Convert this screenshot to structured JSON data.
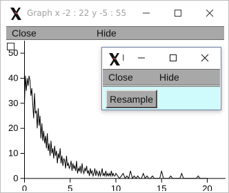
{
  "main_window": {
    "title": "Graph  x -2 : 22  y -5 : 55",
    "menu": {
      "close_label": "Close",
      "hide_label": "Hide"
    }
  },
  "small_window": {
    "title": "I",
    "menu": {
      "close_label": "Close",
      "hide_label": "Hide"
    },
    "resample_label": "Resample",
    "panel_color": "#d0fbfd"
  },
  "chart_data": {
    "type": "line",
    "title": "",
    "xlabel": "",
    "ylabel": "",
    "xlim": [
      -2,
      22
    ],
    "ylim": [
      -5,
      55
    ],
    "x_ticks": [
      0,
      5,
      10,
      15,
      20
    ],
    "y_ticks": [
      0,
      10,
      20,
      30,
      40,
      50
    ],
    "series": [
      {
        "x": [
          0.0,
          0.1,
          0.2,
          0.3,
          0.4,
          0.5,
          0.6,
          0.7,
          0.8,
          0.9,
          1.0,
          1.1,
          1.2,
          1.3,
          1.4,
          1.5,
          1.6,
          1.7,
          1.8,
          1.9,
          2.0,
          2.1,
          2.2,
          2.3,
          2.4,
          2.5,
          2.6,
          2.7,
          2.8,
          2.9,
          3.0,
          3.1,
          3.2,
          3.3,
          3.4,
          3.5,
          3.6,
          3.7,
          3.8,
          3.9,
          4.0,
          4.1,
          4.2,
          4.3,
          4.4,
          4.5,
          4.6,
          4.7,
          4.8,
          4.9,
          5.0,
          5.1,
          5.2,
          5.3,
          5.4,
          5.5,
          5.6,
          5.7,
          5.8,
          5.9,
          6.0,
          6.1,
          6.2,
          6.3,
          6.4,
          6.5,
          6.6,
          6.7,
          6.8,
          6.9,
          7.0,
          7.1,
          7.2,
          7.3,
          7.4,
          7.5,
          7.6,
          7.7,
          7.8,
          7.9,
          8.0,
          8.1,
          8.2,
          8.3,
          8.4,
          8.5,
          8.6,
          8.7,
          8.8,
          8.9,
          9.0,
          9.1,
          9.2,
          9.3,
          9.4,
          9.5,
          9.6,
          9.7,
          9.8,
          9.9,
          10.0,
          10.2,
          10.4,
          10.6,
          10.8,
          11.0,
          11.2,
          11.4,
          11.6,
          11.8,
          12.0,
          12.2,
          12.4,
          12.6,
          12.8,
          13.0,
          13.2,
          13.4,
          13.6,
          13.8,
          14.0,
          14.2,
          14.4,
          14.6,
          14.8,
          15.0,
          15.2,
          15.4,
          15.6,
          15.8,
          16.0,
          16.2,
          16.4,
          16.6,
          16.8,
          17.0,
          17.2,
          17.4,
          17.6,
          17.8,
          18.0,
          18.2,
          18.4,
          18.6,
          18.8,
          19.0,
          19.2,
          19.4,
          19.6,
          19.8,
          20.0
        ],
        "y": [
          30,
          41,
          35,
          40,
          37,
          41,
          39,
          33,
          36,
          30,
          24,
          34,
          26,
          27,
          20,
          28,
          21,
          25,
          16,
          22,
          15,
          19,
          14,
          17,
          12,
          18,
          11,
          14,
          9,
          15,
          10,
          12,
          8,
          13,
          9,
          11,
          6,
          10,
          8,
          12,
          6,
          9,
          5,
          8,
          7,
          4,
          9,
          5,
          6,
          4,
          5,
          7,
          3,
          6,
          4,
          5,
          3,
          7,
          2,
          4,
          3,
          5,
          2,
          6,
          3,
          2,
          4,
          3,
          5,
          2,
          3,
          1,
          4,
          2,
          3,
          1,
          2,
          4,
          1,
          3,
          2,
          1,
          3,
          1,
          2,
          4,
          1,
          2,
          1,
          3,
          1,
          2,
          1,
          2,
          1,
          3,
          1,
          2,
          1,
          1,
          2,
          1,
          0,
          1,
          2,
          0,
          1,
          0,
          3,
          0,
          1,
          0,
          1,
          0,
          0,
          2,
          0,
          1,
          0,
          0,
          1,
          0,
          0,
          0,
          0,
          3,
          0,
          0,
          0,
          0,
          1,
          0,
          0,
          0,
          0,
          0,
          2,
          0,
          0,
          0,
          0,
          0,
          0,
          0,
          0,
          1,
          0,
          0,
          0,
          0,
          0
        ]
      }
    ]
  }
}
